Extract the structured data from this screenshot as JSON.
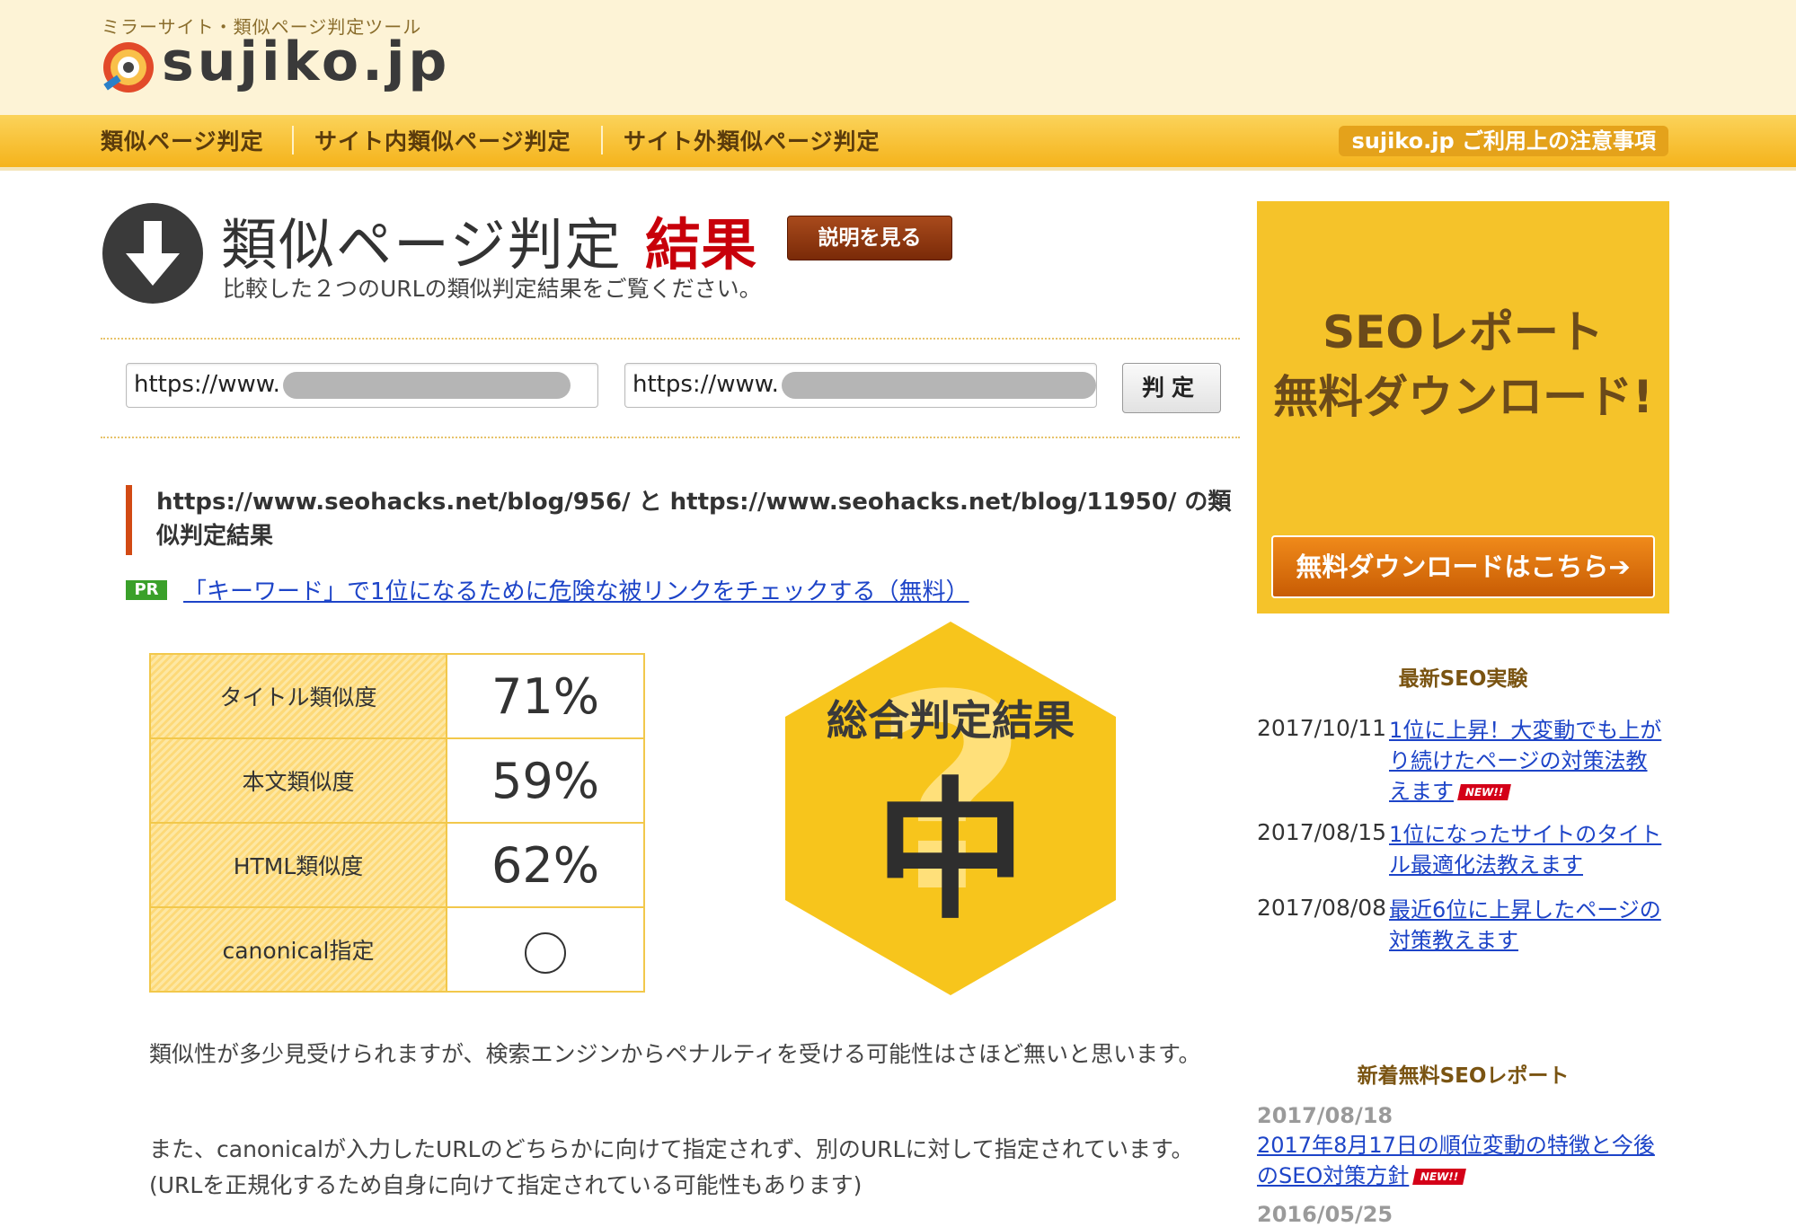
{
  "header": {
    "tagline": "ミラーサイト・類似ページ判定ツール",
    "logo_text": "sujiko.jp"
  },
  "nav": {
    "items": [
      "類似ページ判定",
      "サイト内類似ページ判定",
      "サイト外類似ページ判定"
    ],
    "notice": "sujiko.jp ご利用上の注意事項"
  },
  "title": {
    "main": "類似ページ判定",
    "result": "結果",
    "explain_button": "説明を見る",
    "subtitle": "比較した２つのURLの類似判定結果をご覧ください。"
  },
  "form": {
    "url1_prefix": "https://www.",
    "url2_prefix": "https://www.",
    "judge_button": "判定"
  },
  "result": {
    "heading": "https://www.seohacks.net/blog/956/ と https://www.seohacks.net/blog/11950/ の類似判定結果",
    "pr_badge": "PR",
    "pr_link": "「キーワード」で1位になるために危険な被リンクをチェックする（無料）"
  },
  "table": [
    {
      "label": "タイトル類似度",
      "value": "71%"
    },
    {
      "label": "本文類似度",
      "value": "59%"
    },
    {
      "label": "HTML類似度",
      "value": "62%"
    },
    {
      "label": "canonical指定",
      "value": ""
    }
  ],
  "overall": {
    "label": "総合判定結果",
    "grade": "中"
  },
  "paragraphs": [
    "類似性が多少見受けられますが、検索エンジンからペナルティを受ける可能性はさほど無いと思います。",
    "また、canonicalが入力したURLのどちらかに向けて指定されず、別のURLに対して指定されています。(URLを正規化するため自身に向けて指定されている可能性もあります)"
  ],
  "sidebar": {
    "ad_line1": "SEOレポート",
    "ad_line2": "無料ダウンロード!",
    "ad_button": "無料ダウンロードはこちら➔",
    "seo_heading": "最新SEO実験",
    "news": [
      {
        "date": "2017/10/11",
        "title": "1位に上昇！大変動でも上がり続けたページの対策法教えます",
        "new": "NEW!!"
      },
      {
        "date": "2017/08/15",
        "title": "1位になったサイトのタイトル最適化法教えます"
      },
      {
        "date": "2017/08/08",
        "title": "最近6位に上昇したページの対策教えます"
      }
    ],
    "report_heading": "新着無料SEOレポート",
    "reports": [
      {
        "date": "2017/08/18",
        "title": "2017年8月17日の順位変動の特徴と今後のSEO対策方針",
        "new": "NEW!!"
      },
      {
        "date": "2016/05/25"
      }
    ]
  },
  "colors": {
    "accent_red": "#c8000a",
    "nav_yellow": "#f5b31b",
    "link_blue": "#1d44c8"
  }
}
